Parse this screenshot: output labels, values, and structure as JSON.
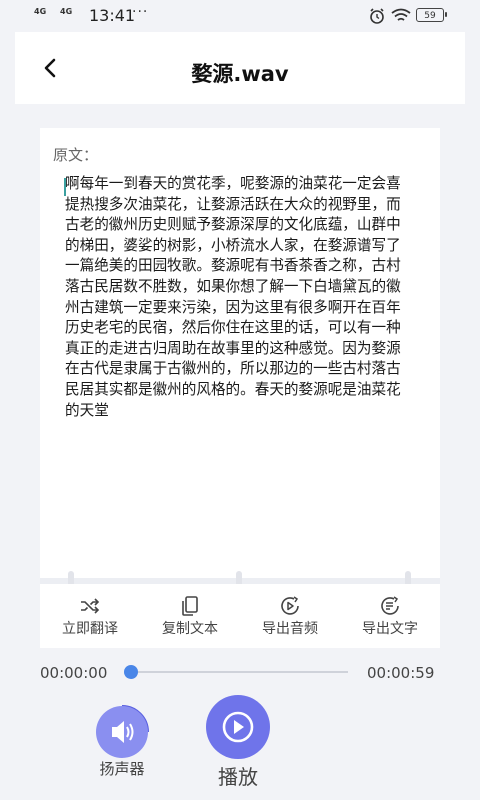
{
  "status_bar": {
    "signal_1": "4G",
    "signal_2": "4G",
    "time": "13:41",
    "more": "···",
    "battery": "59"
  },
  "header": {
    "title": "婺源.wav"
  },
  "transcript": {
    "label": "原文：",
    "text": "啊每年一到春天的赏花季，呢婺源的油菜花一定会喜提热搜多次油菜花，让婺源活跃在大众的视野里，而古老的徽州历史则赋予婺源深厚的文化底蕴，山群中的梯田，婆娑的树影，小桥流水人家，在婺源谱写了一篇绝美的田园牧歌。婺源呢有书香茶香之称，古村落古民居数不胜数，如果你想了解一下白墙黛瓦的徽州古建筑一定要来污染，因为这里有很多啊开在百年历史老宅的民宿，然后你住在这里的话，可以有一种真正的走进古归周助在故事里的这种感觉。因为婺源在古代是隶属于古徽州的，所以那边的一些古村落古民居其实都是徽州的风格的。春天的婺源呢是油菜花的天堂"
  },
  "actions": [
    {
      "label": "立即翻译",
      "icon": "shuffle-icon"
    },
    {
      "label": "复制文本",
      "icon": "copy-icon"
    },
    {
      "label": "导出音频",
      "icon": "export-audio-icon"
    },
    {
      "label": "导出文字",
      "icon": "export-text-icon"
    }
  ],
  "player": {
    "current_time": "00:00:00",
    "total_time": "00:00:59",
    "progress": 0,
    "speaker_label": "扬声器",
    "play_label": "播放"
  },
  "colors": {
    "accent": "#6f74ea",
    "progress_knob": "#4a86e8",
    "background": "#f2f3f7"
  }
}
